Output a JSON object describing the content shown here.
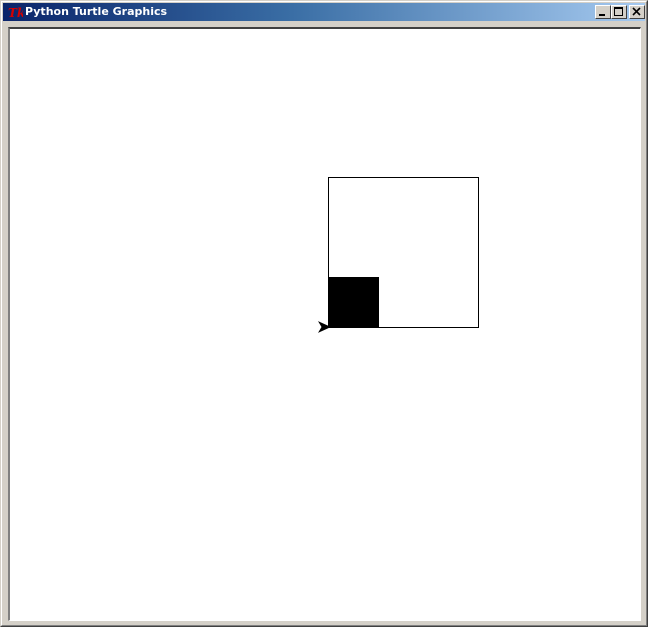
{
  "window": {
    "title": "Python Turtle Graphics",
    "icon": "tk-feather-icon",
    "buttons": {
      "minimize": "minimize-icon",
      "maximize": "maximize-icon",
      "close": "close-icon"
    }
  },
  "canvas": {
    "background": "#ffffff",
    "drawing": {
      "outline_square": "square-outline",
      "filled_square": "filled-square",
      "cursor": "turtle-arrow-icon",
      "stroke_color": "#000000",
      "fill_color": "#000000"
    }
  }
}
